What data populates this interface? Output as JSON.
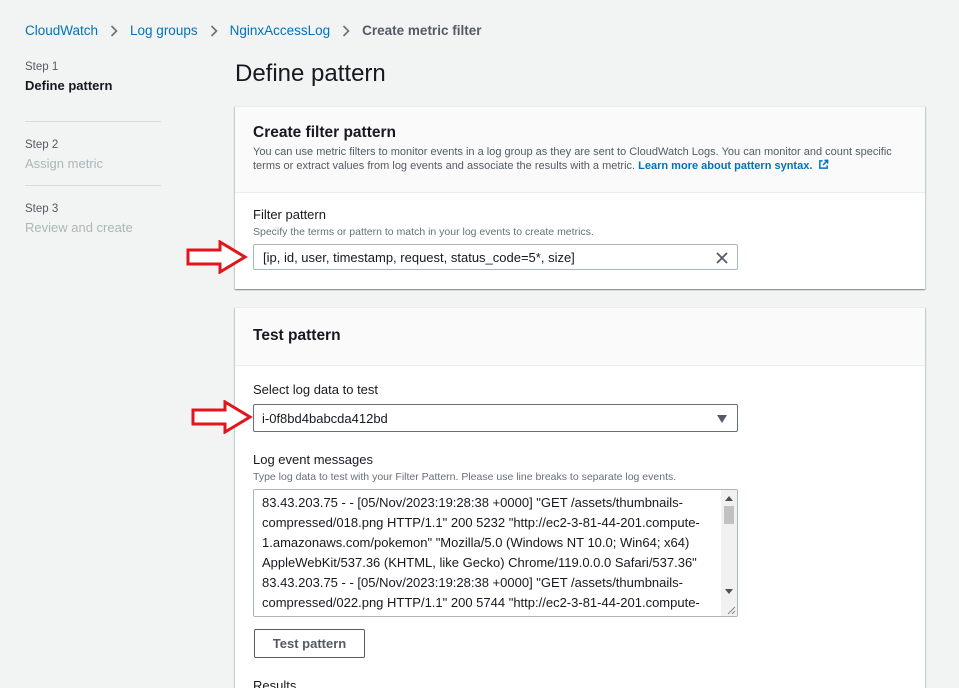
{
  "breadcrumb": {
    "items": [
      "CloudWatch",
      "Log groups",
      "NginxAccessLog"
    ],
    "current": "Create metric filter"
  },
  "steps": [
    {
      "num": "Step 1",
      "title": "Define pattern"
    },
    {
      "num": "Step 2",
      "title": "Assign metric"
    },
    {
      "num": "Step 3",
      "title": "Review and create"
    }
  ],
  "page_title": "Define pattern",
  "filter_section": {
    "title": "Create filter pattern",
    "description": "You can use metric filters to monitor events in a log group as they are sent to CloudWatch Logs. You can monitor and count specific terms or extract values from log events and associate the results with a metric.",
    "learn_more": "Learn more about pattern syntax.",
    "field_label": "Filter pattern",
    "field_hint": "Specify the terms or pattern to match in your log events to create metrics.",
    "value": "[ip, id, user, timestamp, request, status_code=5*, size]"
  },
  "test_section": {
    "title": "Test pattern",
    "select_label": "Select log data to test",
    "selected": "i-0f8bd4babcda412bd",
    "messages_label": "Log event messages",
    "messages_hint": "Type log data to test with your Filter Pattern. Please use line breaks to separate log events.",
    "messages": "83.43.203.75 - - [05/Nov/2023:19:28:38 +0000] \"GET /assets/thumbnails-compressed/018.png HTTP/1.1\" 200 5232 \"http://ec2-3-81-44-201.compute-1.amazonaws.com/pokemon\" \"Mozilla/5.0 (Windows NT 10.0; Win64; x64) AppleWebKit/537.36 (KHTML, like Gecko) Chrome/119.0.0.0 Safari/537.36\"\n83.43.203.75 - - [05/Nov/2023:19:28:38 +0000] \"GET /assets/thumbnails-compressed/022.png HTTP/1.1\" 200 5744 \"http://ec2-3-81-44-201.compute-1.amazonaws.com/pokemon\" \"Mozilla/5.0 (Windows NT 10.0; Win64; x64) AppleWebKit/537.36 (KHTML, like Gecko) Chrome/119.0.0.0 Safari/537.36\"",
    "button": "Test pattern",
    "results_label": "Results"
  },
  "colors": {
    "link": "#0073bb",
    "annotation_arrow": "#e0161c",
    "background": "#f2f3f3"
  },
  "icons": {
    "breadcrumb_separator": "chevron-right-icon",
    "external_link": "external-link-icon",
    "clear": "close-icon",
    "dropdown": "caret-down-icon",
    "annotation": "outline-arrow-right-icon"
  }
}
